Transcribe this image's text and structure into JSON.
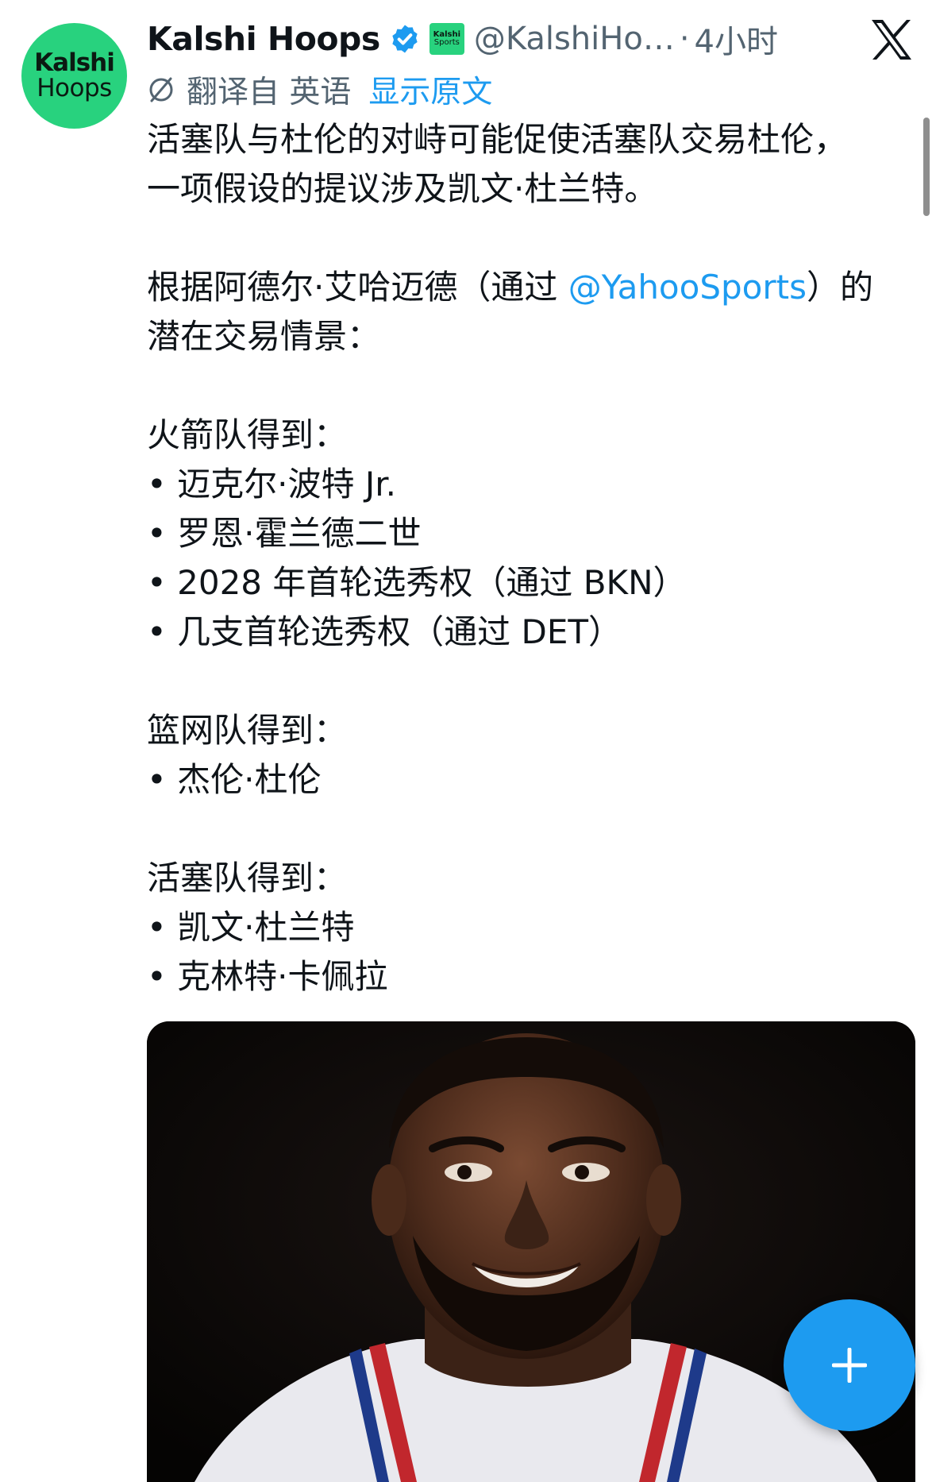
{
  "author": {
    "avatar_line1": "Kalshi",
    "avatar_line2": "Hoops",
    "display_name": "Kalshi Hoops",
    "affiliate_badge_line1": "Kalshi",
    "affiliate_badge_line2": "Sports",
    "handle": "@KalshiHo…",
    "separator": "·",
    "timestamp": "4小时"
  },
  "translation": {
    "label": "翻译自 英语",
    "show_original": "显示原文"
  },
  "tweet": {
    "line1": "活塞队与杜伦的对峙可能促使活塞队交易杜伦，",
    "line2": "一项假设的提议涉及凯文·杜兰特。",
    "line3_before": "根据阿德尔·艾哈迈德（通过 ",
    "line3_mention": "@YahooSports",
    "line3_after": "）的",
    "line4": "潜在交易情景：",
    "rockets_heading": "火箭队得到：",
    "rockets_items": [
      "• 迈克尔·波特 Jr.",
      "• 罗恩·霍兰德二世",
      "• 2028 年首轮选秀权（通过 BKN）",
      "• 几支首轮选秀权（通过 DET）"
    ],
    "nets_heading": "篮网队得到：",
    "nets_items": [
      "• 杰伦·杜伦"
    ],
    "pistons_heading": "活塞队得到：",
    "pistons_items": [
      "• 凯文·杜兰特",
      "• 克林特·卡佩拉"
    ]
  },
  "icons": {
    "verified": "verified-badge-icon",
    "x_logo": "x-logo-icon",
    "translate": "translate-icon",
    "compose": "plus-icon"
  },
  "colors": {
    "link": "#1d9bf0",
    "secondary_text": "#536471",
    "brand_green": "#28d27e",
    "fab": "#1d9bf0"
  }
}
